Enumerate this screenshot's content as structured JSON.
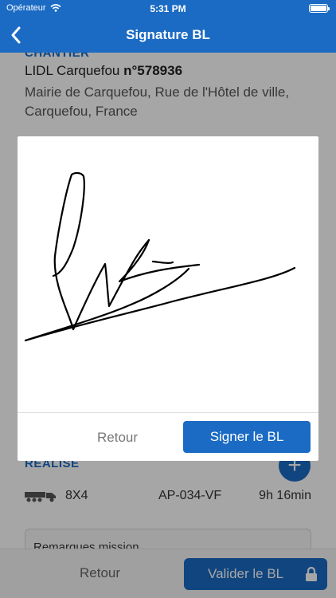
{
  "status_bar": {
    "carrier": "Opérateur",
    "time": "5:31 PM"
  },
  "nav": {
    "title": "Signature BL"
  },
  "site": {
    "section_label": "CHANTIER",
    "name_prefix": "LIDL Carquefou ",
    "name_number": "n°578936",
    "address": "Mairie de Carquefou, Rue de l'Hôtel de ville, Carquefou, France"
  },
  "realise": {
    "section_label": "RÉALISÉ",
    "config": "8X4",
    "plate": "AP-034-VF",
    "duration": "9h 16min"
  },
  "remarks": {
    "label": "Remarques mission"
  },
  "bottom": {
    "retour_label": "Retour",
    "valider_label": "Valider le BL"
  },
  "modal": {
    "retour_label": "Retour",
    "signer_label": "Signer le BL"
  },
  "colors": {
    "accent": "#1b6bc4"
  },
  "icons": [
    "wifi-icon",
    "battery-icon",
    "back-chevron-icon",
    "plus-icon",
    "truck-icon",
    "lock-icon"
  ]
}
